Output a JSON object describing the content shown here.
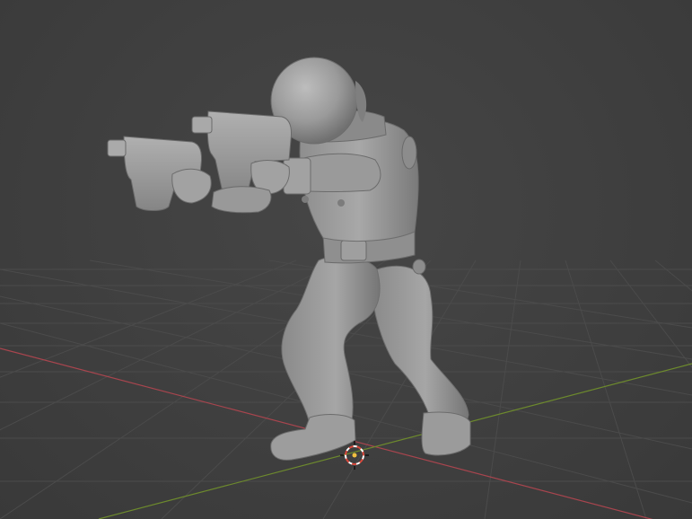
{
  "viewport": {
    "background": "#3d3d3d",
    "grid_line_color": "#4a4a4a",
    "x_axis_color": "#b04a52",
    "y_axis_color": "#6f8a2e",
    "model_color": "#9c9c9c",
    "model_shadow_color": "#6a6a6a",
    "cursor_color_red": "#d9483b",
    "cursor_color_white": "#ffffff",
    "cursor_center_color": "#f0c040"
  },
  "scene": {
    "object_description": "sculpted figure",
    "cursor": "3d-cursor-icon"
  }
}
